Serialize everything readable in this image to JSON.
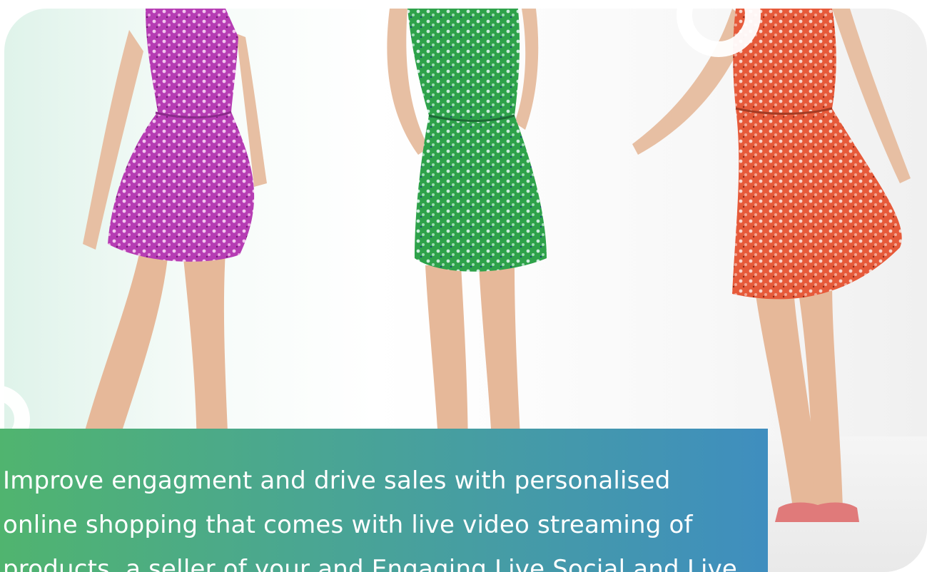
{
  "image": {
    "subject": "three-models-floral-dresses",
    "dress_colors": [
      "#b63db4",
      "#2ea24a",
      "#e65a3a"
    ]
  },
  "caption": {
    "line1": "Improve engagment and drive sales with personalised",
    "line2": "online shopping that comes with live video streaming of",
    "line3": "products, a seller of your and Engaging Live Social and Live"
  },
  "colors": {
    "caption_gradient_start": "#50b46f",
    "caption_gradient_end": "#3f8ebf",
    "caption_text": "#ffffff"
  }
}
